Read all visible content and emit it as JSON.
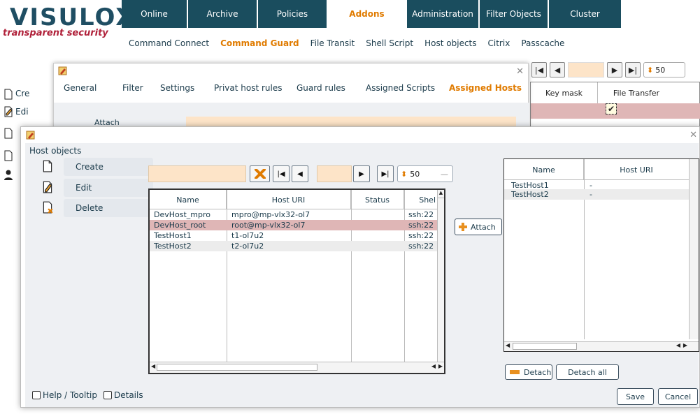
{
  "brand": {
    "logo": "VISULOX",
    "tagline": "transparent security"
  },
  "main_nav": {
    "tabs": [
      {
        "label": "Online",
        "active": false
      },
      {
        "label": "Archive",
        "active": false
      },
      {
        "label": "Policies",
        "active": false
      },
      {
        "label": "Addons",
        "active": true
      },
      {
        "label": "Administration",
        "active": false
      },
      {
        "label": "Filter Objects",
        "active": false
      },
      {
        "label": "Cluster",
        "active": false
      }
    ]
  },
  "sub_nav": {
    "items": [
      {
        "label": "Command Connect",
        "active": false
      },
      {
        "label": "Command Guard",
        "active": true
      },
      {
        "label": "File Transit",
        "active": false
      },
      {
        "label": "Shell Script",
        "active": false
      },
      {
        "label": "Host objects",
        "active": false
      },
      {
        "label": "Citrix",
        "active": false
      },
      {
        "label": "Passcache",
        "active": false
      }
    ]
  },
  "background_page": {
    "side_actions": [
      "Cre",
      "Edi"
    ],
    "page_size": "50",
    "columns": [
      "Key mask",
      "File Transfer"
    ],
    "file_transfer_checked": true
  },
  "command_guard_dialog": {
    "tabs": [
      "General",
      "Filter",
      "Settings",
      "Privat host rules",
      "Guard rules",
      "Assigned Scripts",
      "Assigned Hosts"
    ],
    "active_tab": "Assigned Hosts",
    "attach_label": "Attach"
  },
  "host_objects_dialog": {
    "section_title": "Host objects",
    "actions": [
      {
        "label": "Create",
        "icon": "document-icon"
      },
      {
        "label": "Edit",
        "icon": "edit-document-icon"
      },
      {
        "label": "Delete",
        "icon": "delete-document-icon"
      }
    ],
    "filter": {
      "value": "",
      "page_size": "50"
    },
    "host_table": {
      "columns": [
        "Name",
        "Host URI",
        "Status",
        "Shel"
      ],
      "rows": [
        {
          "name": "DevHost_mpro",
          "uri": "mpro@mp-vlx32-ol7",
          "status": "",
          "shell": "ssh:22",
          "selected": false
        },
        {
          "name": "DevHost_root",
          "uri": "root@mp-vlx32-ol7",
          "status": "",
          "shell": "ssh:22",
          "selected": true
        },
        {
          "name": "TestHost1",
          "uri": "t1-ol7u2",
          "status": "",
          "shell": "ssh:22",
          "selected": false
        },
        {
          "name": "TestHost2",
          "uri": "t2-ol7u2",
          "status": "",
          "shell": "ssh:22",
          "selected": false
        }
      ]
    },
    "attach_label": "Attach",
    "assigned_table": {
      "columns": [
        "Name",
        "Host URI"
      ],
      "rows": [
        {
          "name": "TestHost1",
          "uri": "-"
        },
        {
          "name": "TestHost2",
          "uri": "-"
        }
      ]
    },
    "detach_label": "Detach",
    "detach_all_label": "Detach all",
    "footer": {
      "help_tooltip_label": "Help / Tooltip",
      "details_label": "Details",
      "save_label": "Save",
      "cancel_label": "Cancel"
    }
  },
  "colors": {
    "nav_bg": "#1a4d5e",
    "accent": "#e07b00",
    "logo_red": "#b0213a",
    "selected_row": "#dfb6b6",
    "filter_bg": "#fde4c8"
  }
}
